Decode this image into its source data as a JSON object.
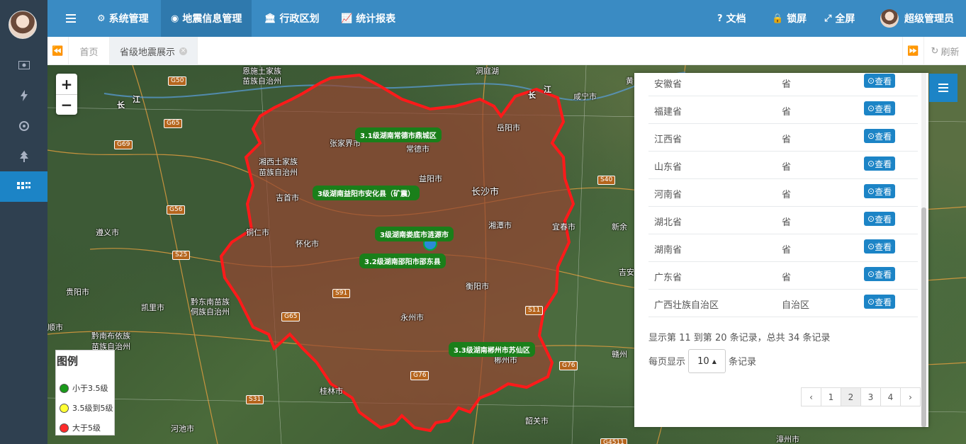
{
  "rail": {
    "items": [
      "money-icon",
      "bolt-icon",
      "target-icon",
      "tree-icon",
      "apps-icon"
    ]
  },
  "topbar": {
    "menu": [
      {
        "label": "系统管理",
        "icon": "gear-icon"
      },
      {
        "label": "地震信息管理",
        "icon": "map-marker-icon"
      },
      {
        "label": "行政区划",
        "icon": "institution-icon"
      },
      {
        "label": "统计报表",
        "icon": "area-chart-icon"
      }
    ],
    "docs": "文档",
    "lock": "锁屏",
    "fullscreen": "全屏",
    "user": "超级管理员"
  },
  "tabs": {
    "home": "首页",
    "current": "省级地震展示",
    "refresh": "刷新"
  },
  "map": {
    "cities": [
      "恩施土家族",
      "苗族自治州",
      "洞庭湖",
      "岳阳市",
      "咸宁市",
      "常德市",
      "张家界市",
      "湘西土家族",
      "苗族自治州",
      "益阳市",
      "长沙市",
      "吉首市",
      "湘潭市",
      "宜春市",
      "新余",
      "遵义市",
      "铜仁市",
      "怀化市",
      "吉安",
      "贵阳市",
      "黔东南苗族",
      "侗族自治州",
      "凯里市",
      "衡阳市",
      "永州市",
      "顺市",
      "黔南布依族",
      "苗族自治州",
      "郴州市",
      "桂林市",
      "赣州",
      "韶关市",
      "河池市",
      "漳州市",
      "长",
      "江",
      "长",
      "江",
      "黄"
    ],
    "highways": [
      "G50",
      "G65",
      "G69",
      "G56",
      "S25",
      "G65",
      "S91",
      "S40",
      "S11",
      "G76",
      "G76",
      "S31",
      "G4511"
    ],
    "quakes": [
      "3.1级湖南常德市鼎城区",
      "3级湖南益阳市安化县（矿震）",
      "3级湖南娄底市涟源市",
      "3.2级湖南邵阳市邵东县",
      "3.3级湖南郴州市苏仙区"
    ],
    "legend": {
      "title": "图例",
      "items": [
        {
          "label": "小于3.5级",
          "color": "#1a9a1a"
        },
        {
          "label": "3.5级到5级",
          "color": "#ffff33"
        },
        {
          "label": "大于5级",
          "color": "#ff2a2a"
        }
      ]
    },
    "zoom_in": "+",
    "zoom_out": "−"
  },
  "panel": {
    "rows": [
      {
        "name": "安徽省",
        "type": "省",
        "action": "查看"
      },
      {
        "name": "福建省",
        "type": "省",
        "action": "查看"
      },
      {
        "name": "江西省",
        "type": "省",
        "action": "查看"
      },
      {
        "name": "山东省",
        "type": "省",
        "action": "查看"
      },
      {
        "name": "河南省",
        "type": "省",
        "action": "查看"
      },
      {
        "name": "湖北省",
        "type": "省",
        "action": "查看"
      },
      {
        "name": "湖南省",
        "type": "省",
        "action": "查看"
      },
      {
        "name": "广东省",
        "type": "省",
        "action": "查看"
      },
      {
        "name": "广西壮族自治区",
        "type": "自治区",
        "action": "查看"
      }
    ],
    "summary": "显示第 11 到第 20 条记录，总共 34 条记录",
    "per_page_prefix": "每页显示",
    "per_page_value": "10",
    "per_page_suffix": "条记录",
    "pager": [
      "‹",
      "1",
      "2",
      "3",
      "4",
      "›"
    ],
    "current_page": "2"
  }
}
